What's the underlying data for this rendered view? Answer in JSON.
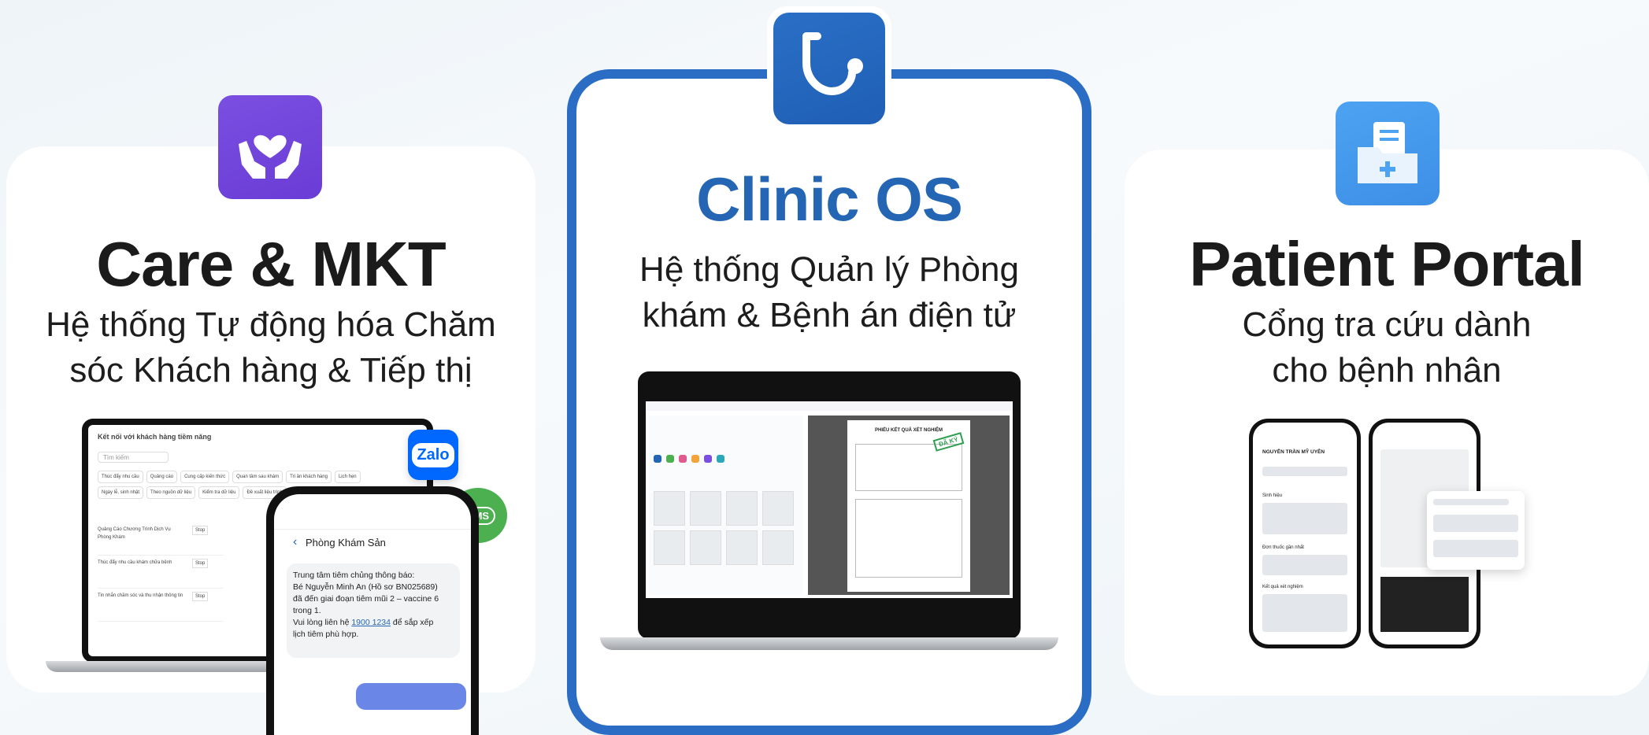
{
  "care": {
    "title": "Care & MKT",
    "subtitle_line1": "Hệ thống Tự động hóa Chăm",
    "subtitle_line2": "sóc Khách hàng & Tiếp thị",
    "laptop": {
      "header": "Kết nối với khách hàng tiềm năng",
      "search_placeholder": "Tìm kiếm",
      "chips": [
        "Thúc đẩy nhu cầu",
        "Quảng cáo",
        "Cung cấp kiến thức",
        "Quan tâm sau khám",
        "Tri ân khách hàng",
        "Lịch hẹn",
        "Ngày lễ, sinh nhật",
        "Theo nguồn dữ liệu",
        "Kiểm tra dữ liệu",
        "Đề xuất liệu trình"
      ],
      "rows": [
        {
          "title": "Quảng Cáo Chương Trình Dịch Vụ Phòng Khám",
          "status": "Stop"
        },
        {
          "title": "Thúc đẩy nhu cầu khám chữa bệnh",
          "status": "Stop"
        },
        {
          "title": "Tin nhắn chăm sóc và thu nhận thông tin",
          "status": "Stop"
        }
      ]
    },
    "zalo_label": "Zalo",
    "sms_label": "SMS",
    "phone": {
      "back_label": "Phòng Khám Sản",
      "message_line1": "Trung tâm tiêm chủng thông báo:",
      "message_line2": "Bé Nguyễn Minh An (Hồ sơ BN025689)",
      "message_line3": "đã đến giai đoạn tiêm mũi 2 – vaccine 6",
      "message_line4": "trong 1.",
      "message_line5_prefix": "Vui lòng liên hệ",
      "message_phone": "1900 1234",
      "message_line5_suffix": "để sắp xếp",
      "message_line6": "lịch tiêm phù hợp."
    }
  },
  "clinic": {
    "title": "Clinic OS",
    "subtitle_line1": "Hệ thống Quản lý Phòng",
    "subtitle_line2": "khám & Bệnh án điện tử",
    "laptop": {
      "report_title": "PHIẾU KẾT QUẢ XÉT NGHIỆM",
      "stamp": "ĐÃ KÝ"
    }
  },
  "portal": {
    "title": "Patient Portal",
    "subtitle_line1": "Cổng tra cứu dành",
    "subtitle_line2": "cho bệnh nhân",
    "phone1": {
      "patient_name": "NGUYỄN TRẦN MỸ UYÊN",
      "section_vitals": "Sinh hiệu",
      "section_rx": "Đơn thuốc gần nhất",
      "section_results": "Kết quả xét nghiệm"
    }
  },
  "colors": {
    "clinic_accent": "#2566b4",
    "care_icon": "#6a3cd6",
    "portal_icon": "#3d8fe6",
    "zalo": "#0068ff",
    "sms": "#4caf50"
  }
}
